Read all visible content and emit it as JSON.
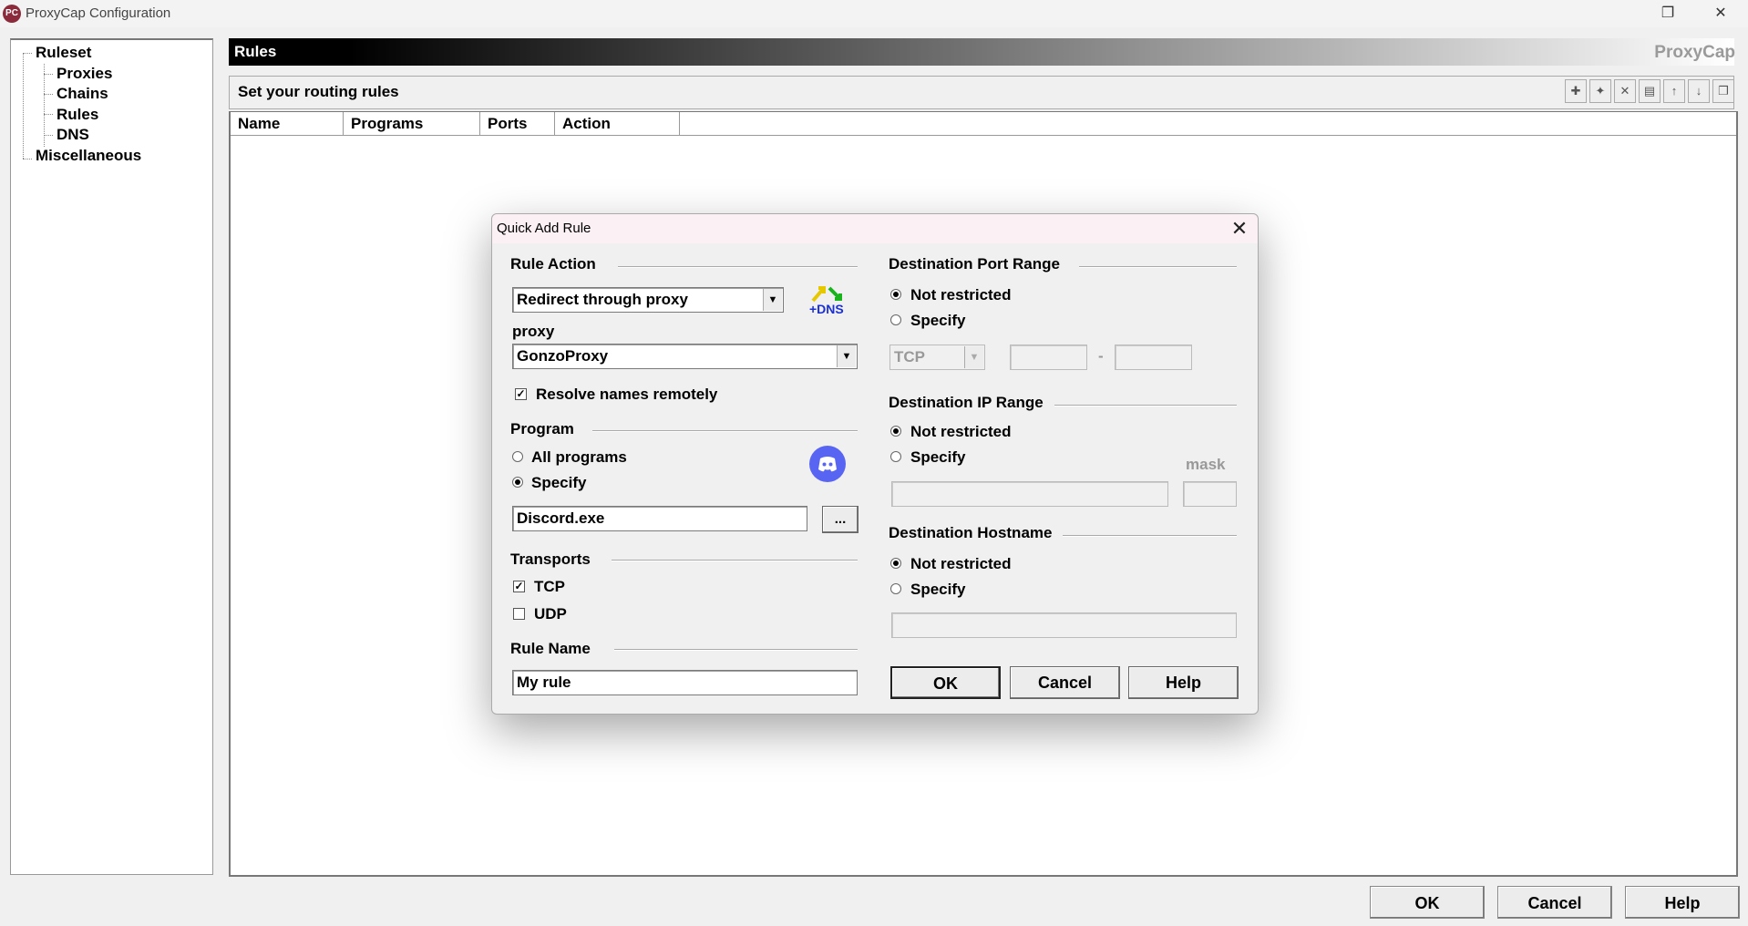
{
  "window": {
    "title": "ProxyCap Configuration",
    "restore_glyph": "❐",
    "close_glyph": "✕",
    "app_icon_glyph": "PC"
  },
  "tree": {
    "items": [
      {
        "label": "Ruleset"
      },
      {
        "label": "Proxies"
      },
      {
        "label": "Chains"
      },
      {
        "label": "Rules"
      },
      {
        "label": "DNS"
      },
      {
        "label": "Miscellaneous"
      }
    ]
  },
  "header": {
    "title": "Rules",
    "brand": "ProxyCap",
    "subtitle": "Set your routing rules"
  },
  "toolbar": {
    "icons": [
      "new-rule-icon",
      "wizard-icon",
      "delete-icon",
      "properties-icon",
      "move-up-icon",
      "move-down-icon",
      "copy-icon"
    ],
    "glyphs": [
      "✚",
      "✦",
      "✕",
      "▤",
      "↑",
      "↓",
      "❐"
    ]
  },
  "list": {
    "columns": [
      "Name",
      "Programs",
      "Ports",
      "Action"
    ]
  },
  "footer": {
    "ok": "OK",
    "cancel": "Cancel",
    "help": "Help"
  },
  "dialog": {
    "title": "Quick Add Rule",
    "close_glyph": "✕",
    "rule_action": {
      "heading": "Rule Action",
      "selected": "Redirect through proxy",
      "dns_badge": "+DNS"
    },
    "proxy": {
      "label": "proxy",
      "selected": "GonzoProxy",
      "resolve_remotely_label": "Resolve names remotely",
      "resolve_remotely_checked": true
    },
    "program": {
      "heading": "Program",
      "all_label": "All programs",
      "specify_label": "Specify",
      "selected": "Specify",
      "value": "Discord.exe",
      "browse_label": "..."
    },
    "transports": {
      "heading": "Transports",
      "tcp_label": "TCP",
      "tcp_checked": true,
      "udp_label": "UDP",
      "udp_checked": false
    },
    "rule_name": {
      "heading": "Rule Name",
      "value": "My rule"
    },
    "dest_port": {
      "heading": "Destination Port Range",
      "not_restricted_label": "Not restricted",
      "specify_label": "Specify",
      "selected": "Not restricted",
      "protocol": "TCP",
      "separator": "-"
    },
    "dest_ip": {
      "heading": "Destination IP Range",
      "not_restricted_label": "Not restricted",
      "specify_label": "Specify",
      "selected": "Not restricted",
      "mask_label": "mask"
    },
    "dest_host": {
      "heading": "Destination Hostname",
      "not_restricted_label": "Not restricted",
      "specify_label": "Specify",
      "selected": "Not restricted"
    },
    "buttons": {
      "ok": "OK",
      "cancel": "Cancel",
      "help": "Help"
    }
  },
  "colors": {
    "discord": "#5865f2",
    "dns_badge": "#1a2fd6"
  }
}
